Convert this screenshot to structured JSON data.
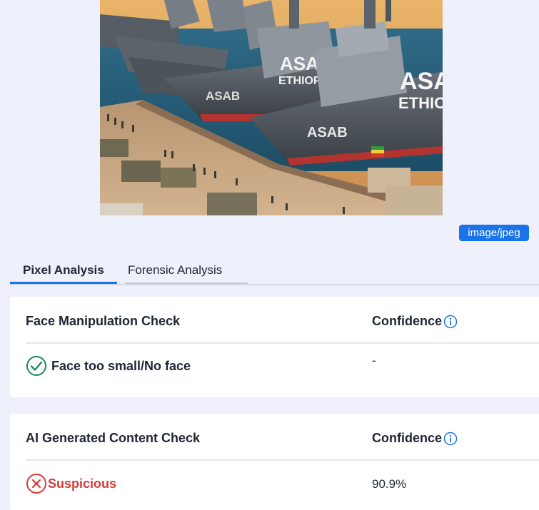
{
  "preview": {
    "hull_text_large": "ASAB",
    "hull_text_small": "ETHIOPIA",
    "hull_text_bow": "ASAB"
  },
  "mime_type": "image/jpeg",
  "tabs": [
    {
      "label": "Pixel Analysis",
      "active": true
    },
    {
      "label": "Forensic Analysis",
      "active": false
    }
  ],
  "face_check": {
    "title": "Face Manipulation Check",
    "confidence_label": "Confidence",
    "result_text": "Face too small/No face",
    "result_icon": "check-circle-icon",
    "confidence_value": "-"
  },
  "ai_check": {
    "title": "AI Generated Content Check",
    "confidence_label": "Confidence",
    "result_text": "Suspicious",
    "result_icon": "x-circle-icon",
    "confidence_value": "90.9%"
  },
  "colors": {
    "accent": "#1a73e8",
    "ok": "#1e8a5a",
    "danger": "#d93a3a"
  }
}
